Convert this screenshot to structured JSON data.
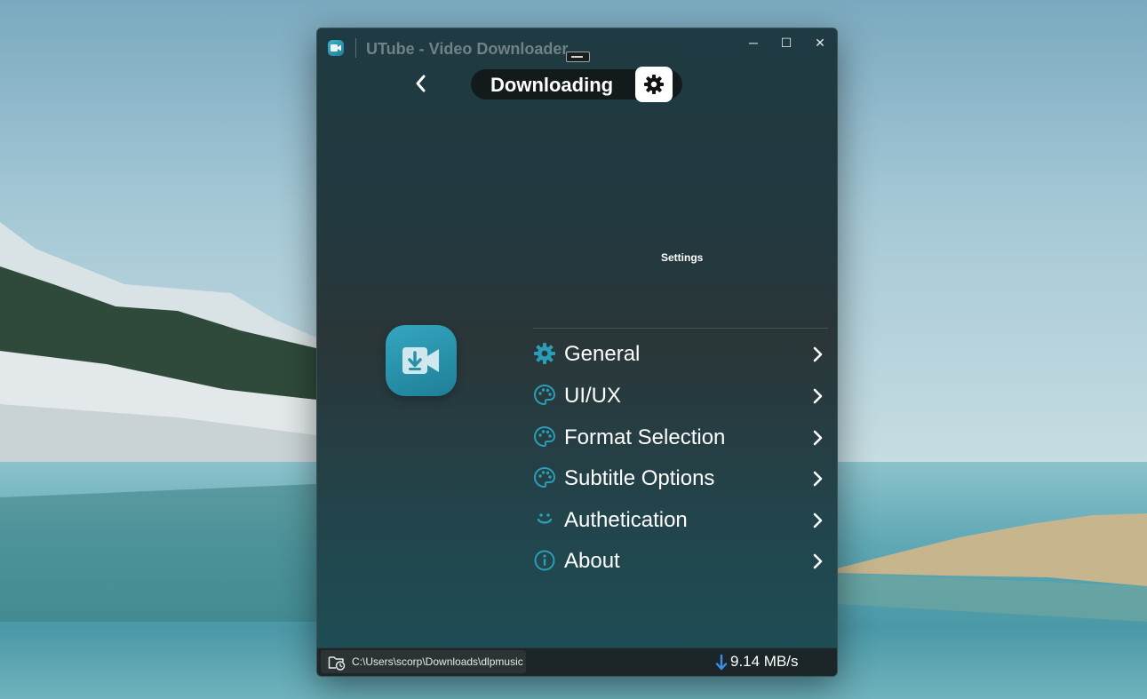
{
  "window": {
    "title": "UTube - Video Downloader",
    "controls": {
      "minimize": "─",
      "maximize": "☐",
      "close": "✕"
    }
  },
  "header": {
    "title": "Downloading",
    "back_icon": "chevron-left-icon",
    "settings_icon": "gear-icon"
  },
  "settings_caption": "Settings",
  "menu": {
    "items": [
      {
        "label": "General",
        "icon": "gear-icon"
      },
      {
        "label": "UI/UX",
        "icon": "palette-icon"
      },
      {
        "label": "Format Selection",
        "icon": "palette-icon"
      },
      {
        "label": "Subtitle Options",
        "icon": "palette-icon"
      },
      {
        "label": "Authetication",
        "icon": "smile-icon"
      },
      {
        "label": "About",
        "icon": "info-icon"
      }
    ]
  },
  "statusbar": {
    "path": "C:\\Users\\scorp\\Downloads\\dlpmusic",
    "speed": "9.14 MB/s"
  },
  "colors": {
    "accent": "#2b9db6",
    "speed_arrow": "#3a8ee6",
    "window_bg_top": "#1f3a42",
    "window_bg_bottom": "#1e4f57"
  }
}
